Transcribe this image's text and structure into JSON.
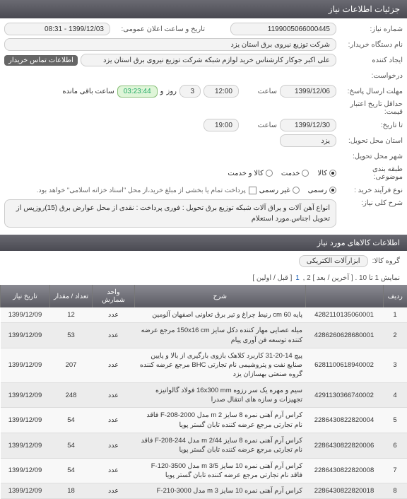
{
  "panel_title": "جزئیات اطلاعات نیاز",
  "labels": {
    "need_no": "شماره نیاز:",
    "public_time": "تاریخ و ساعت اعلان عمومی:",
    "buyer_name": "نام دستگاه خریدار:",
    "creator": "ایجاد کننده",
    "contact": "اطلاعات تماس خریدار",
    "request": "درخواست:",
    "send_deadline": "مهلت ارسال پاسخ:",
    "hour": "ساعت",
    "and": "و",
    "day": "روز",
    "remaining": "ساعت باقی مانده",
    "min_validity": "حداقل تاریخ اعتبار قیمت:",
    "to_date": "تا تاریخ:",
    "delivery_province": "استان محل تحویل:",
    "delivery_city": "شهر محل تحویل:",
    "budget_class": "طبقه بندی موضوعی:",
    "process_type": "نوع فرآیند خرید :",
    "payment_note": "پرداخت تمام یا بخشی از مبلغ خرید،از محل \"اسناد خزانه اسلامی\" خواهد بود.",
    "main_desc": "شرح کلی نیاز:",
    "items_header": "اطلاعات کالاهای مورد نیاز",
    "group": "گروه کالا:",
    "pager_text": "نمایش 1 تا 10 . [ آخرین / بعد ] 2 ,",
    "pager_first": "1",
    "pager_rest": "[ قبل / اولین ]"
  },
  "values": {
    "need_no": "1199005066000445",
    "public_time": "1399/12/03 - 08:31",
    "buyer_name": "شرکت توزیع نیروی برق استان یزد",
    "creator": "علی اکبر جوکار  کارشناس خرید لوازم شبکه  شرکت توزیع نیروی برق استان یزد",
    "send_date": "1399/12/06",
    "send_hour": "12:00",
    "days": "3",
    "timer": "03:23:44",
    "to_date": "1399/12/30",
    "to_hour": "19:00",
    "province": "یزد",
    "main_desc": "انواع آهن آلات و یراق آلات شبکه توزیع برق    تحویل  :  فوری پرداخت :  نقدی از محل عوارض برق   (15)روزپس از تحویل اجناس.مورد استعلام",
    "group": "ابزارآلات الکتریکی"
  },
  "budget_options": [
    {
      "label": "کالا",
      "selected": true
    },
    {
      "label": "خدمت",
      "selected": false
    },
    {
      "label": "کالا و خدمت",
      "selected": false
    }
  ],
  "process_options": [
    {
      "label": "رسمی",
      "selected": true
    },
    {
      "label": "غیر رسمی",
      "selected": false
    }
  ],
  "table": {
    "headers": [
      "ردیف",
      "",
      "شرح",
      "واحد شمارش",
      "تعداد / مقدار",
      "تاریخ نیاز"
    ],
    "rows": [
      {
        "n": "1",
        "code": "4282110135060001",
        "desc": "پایه cm 60 رنیط چراغ و تیر برق تعاونی اصفهان آلومین",
        "unit": "عدد",
        "qty": "12",
        "date": "1399/12/09"
      },
      {
        "n": "2",
        "code": "4286260628680001",
        "desc": "میله عصایی مهار کننده دکل سایز 150x16 cm مرجع عرضه کننده توسعه فن آوری پیام",
        "unit": "عدد",
        "qty": "53",
        "date": "1399/12/09"
      },
      {
        "n": "3",
        "code": "6281100618940002",
        "desc": "پیچ 14-20-31 کاربرد کلاهک بازوی بارگیری از بالا و پایین صنایع نفت و پتروشیمی نام تجارتی BHC مرجع عرضه کننده گروه صنعتی بهسازان یزد",
        "unit": "عدد",
        "qty": "207",
        "date": "1399/12/09"
      },
      {
        "n": "4",
        "code": "4291130366740002",
        "desc": "سیم و مهره یک سر رزوه 16x300 mm فولاد گالوانیزه تجهیزات و سازه های انتقال صدرا",
        "unit": "عدد",
        "qty": "248",
        "date": "1399/12/09"
      },
      {
        "n": "5",
        "code": "2286430822820004",
        "desc": "کراس آرم آهنی نمره 8 سایز 2 m مدل F-208-2000 فاقد نام تجارتی مرجع عرضه کننده تابان گستر پویا",
        "unit": "عدد",
        "qty": "54",
        "date": "1399/12/09"
      },
      {
        "n": "6",
        "code": "2286430822820006",
        "desc": "کراس آرم آهنی نمره 8 سایز m 2/44 مدل F-208-244 فاقد نام تجارتی مرجع عرضه کننده تابان گستر پویا",
        "unit": "عدد",
        "qty": "54",
        "date": "1399/12/09"
      },
      {
        "n": "7",
        "code": "2286430822820008",
        "desc": "کراس آرم آهنی نمره 10 سایز 3/5 m مدل F-120-3500 فاقد نام تجارتی مرجع عرضه کننده تابان گستر پویا",
        "unit": "عدد",
        "qty": "54",
        "date": "1399/12/09"
      },
      {
        "n": "8",
        "code": "2286430822820018",
        "desc": "کراس آرم آهنی نمره 10 سایز 3 m مدل F-210-3000",
        "unit": "عدد",
        "qty": "18",
        "date": "1399/12/09"
      }
    ]
  }
}
